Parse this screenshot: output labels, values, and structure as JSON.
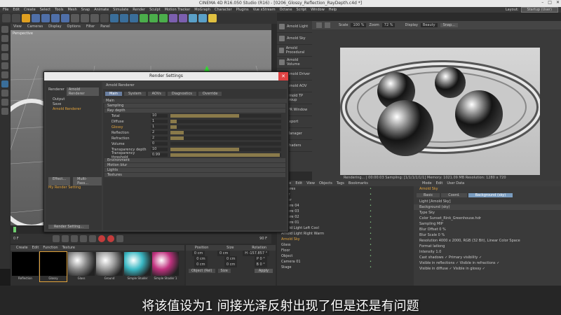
{
  "window": {
    "title": "CINEMA 4D R16.050 Studio (R16) - [0206_Glossy_Reflection_RayDepth.c4d *]"
  },
  "menubar": [
    "File",
    "Edit",
    "Create",
    "Select",
    "Tools",
    "Mesh",
    "Snap",
    "Animate",
    "Simulate",
    "Render",
    "Sculpt",
    "Motion Tracker",
    "MoGraph",
    "Character",
    "Plugins",
    "Vue xStream",
    "Octane",
    "Script",
    "Window",
    "Help"
  ],
  "layout": {
    "label": "Layout:",
    "value": "Startup (User)"
  },
  "viewport": {
    "menu": [
      "View",
      "Cameras",
      "Display",
      "Options",
      "Filter",
      "Panel"
    ],
    "label": "Perspective"
  },
  "plugin_panel": {
    "items": [
      "Arnold Light",
      "Arnold Sky",
      "Arnold Procedural",
      "Arnold Volume",
      "Arnold Driver",
      "Arnold AOV",
      "Arnold TP Group",
      "IPR Window",
      "Export",
      "Manager",
      "Shaders"
    ]
  },
  "ipr": {
    "scale_label": "Scale",
    "scale_value": "100 %",
    "zoom_label": "Zoom",
    "zoom_value": "72 %",
    "display_label": "Display",
    "display_value": "Beauty",
    "snap_label": "Snap...",
    "status": "Rendering... | 00:00:03 Sampling: [1/1/1/1/1/1] Memory: 1021.09 MB Resolution: 1280 x 720"
  },
  "render_settings": {
    "title": "Render Settings",
    "renderer_label": "Renderer",
    "renderer_value": "Arnold Renderer",
    "left_items": [
      "Output",
      "Save",
      "Arnold Renderer"
    ],
    "effect_button": "Effect...",
    "multipass_button": "Multi-Pass...",
    "my_setting": "My Render Setting",
    "render_setting_button": "Render Setting...",
    "panel_title": "Arnold Renderer",
    "tabs": [
      "Main",
      "System",
      "AOVs",
      "Diagnostics",
      "Override"
    ],
    "main_label": "Main",
    "sections": [
      "Sampling",
      "Ray depth"
    ],
    "params": [
      {
        "label": "Total",
        "value": "10",
        "fill": 0.62
      },
      {
        "label": "Diffuse",
        "value": "1",
        "fill": 0.06
      },
      {
        "label": "Glossy",
        "value": "1",
        "fill": 0.06
      },
      {
        "label": "Reflection",
        "value": "2",
        "fill": 0.12
      },
      {
        "label": "Refraction",
        "value": "2",
        "fill": 0.12
      },
      {
        "label": "Volume",
        "value": "0",
        "fill": 0.0
      },
      {
        "label": "Transparency depth",
        "value": "10",
        "fill": 0.62
      },
      {
        "label": "Transparency threshold",
        "value": "0.99",
        "fill": 0.99
      }
    ],
    "sections2": [
      "Environment",
      "Motion blur",
      "Lights",
      "Textures"
    ]
  },
  "object_manager": {
    "menu": [
      "File",
      "Edit",
      "View",
      "Objects",
      "Tags",
      "Bookmarks"
    ],
    "objects": [
      "Spheres",
      "Floor",
      "Cover",
      "Sphere 04",
      "Sphere 03",
      "Sphere 02",
      "Sphere 01",
      "Arnold Light Left Cool",
      "Arnold Light Right Warm",
      "Arnold Sky",
      "Glass",
      "Floor",
      "Object",
      "Camera 01",
      "Stage"
    ],
    "selected": "Arnold Sky"
  },
  "attributes": {
    "menu": [
      "Mode",
      "Edit",
      "User Data"
    ],
    "object_name": "Arnold Sky",
    "tabs": [
      "Basic",
      "Coord.",
      "Background (sky)"
    ],
    "subtitle": "Light [Arnold Sky]",
    "section": "Background (sky)",
    "rows": [
      "Type  Sky",
      "Color  Sunset_Rink_Greenhouse.hdr",
      "Sampling  MIP",
      "Blur Offset  0 %",
      "Blur Scale  0 %",
      "Resolution 4000 x 2000, RGB (32 Bit), Linear Color Space",
      "Format  latlong",
      "Intensity  1.0",
      "Cast shadows  ✓    Primary visibility  ✓",
      "Visible in reflections  ✓    Visible in refractions  ✓",
      "Visible in diffuse  ✓    Visible in glossy  ✓"
    ]
  },
  "materials": {
    "menu": [
      "Create",
      "Edit",
      "Function",
      "Texture"
    ],
    "items": [
      {
        "label": "Reflection",
        "color": "#000000"
      },
      {
        "label": "Glossy",
        "color": "#000000"
      },
      {
        "label": "Glass",
        "color": "#888888"
      },
      {
        "label": "Ground",
        "color": "#9a9a9a"
      },
      {
        "label": "Simple Shader",
        "color": "#3ab8c4"
      },
      {
        "label": "Simple Shader 1",
        "color": "#c0327f"
      }
    ]
  },
  "coordinates": {
    "headers": [
      "Position",
      "Size",
      "Rotation"
    ],
    "rows": [
      [
        "0 cm",
        "0 cm",
        "H -157.857 °"
      ],
      [
        "0 cm",
        "0 cm",
        "P 0 °"
      ],
      [
        "0 cm",
        "0 cm",
        "B 0 °"
      ]
    ],
    "mode": "Object (Rel)",
    "size_mode": "Size",
    "apply": "Apply"
  },
  "timeline": {
    "frame": "0 F",
    "end": "90 F"
  },
  "subtitle": "将该值设为1 间接光泽反射出现了但是还是有问题"
}
